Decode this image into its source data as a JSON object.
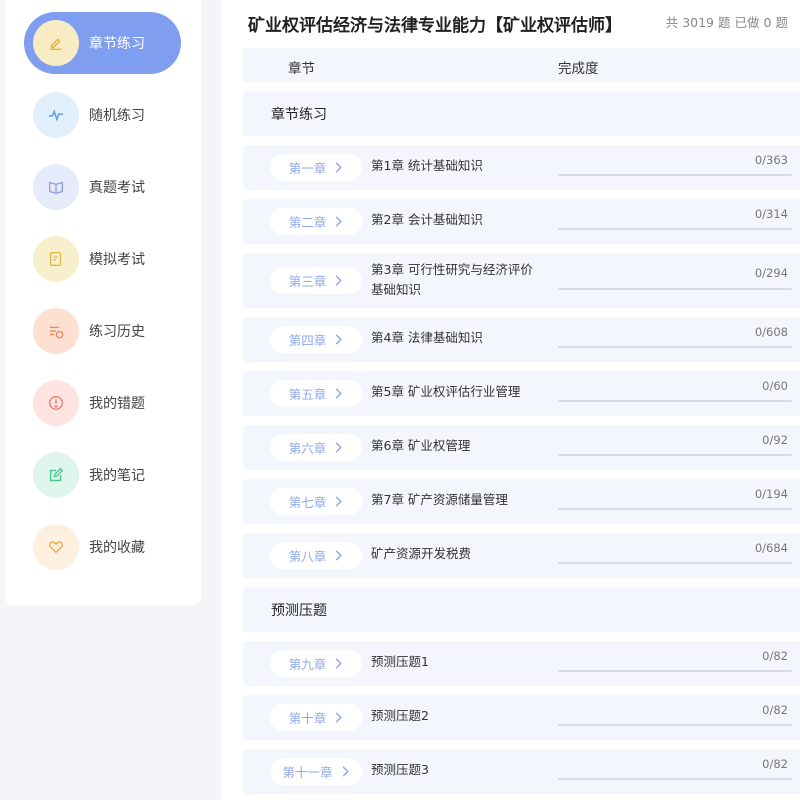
{
  "sidebar": {
    "items": [
      {
        "label": "章节练习",
        "icon": "pencil-icon",
        "active": true,
        "icon_bg": "#f7ecc3",
        "icon_color": "#e8b44a"
      },
      {
        "label": "随机练习",
        "icon": "pulse-icon",
        "active": false,
        "icon_bg": "#e2f0fb",
        "icon_color": "#5b9be6"
      },
      {
        "label": "真题考试",
        "icon": "book-icon",
        "active": false,
        "icon_bg": "#e6ebfb",
        "icon_color": "#8d9fe4"
      },
      {
        "label": "模拟考试",
        "icon": "edit-document-icon",
        "active": false,
        "icon_bg": "#f8efcc",
        "icon_color": "#e7b64a"
      },
      {
        "label": "练习历史",
        "icon": "history-list-icon",
        "active": false,
        "icon_bg": "#fde0d2",
        "icon_color": "#f0875a"
      },
      {
        "label": "我的错题",
        "icon": "alert-circle-icon",
        "active": false,
        "icon_bg": "#fde3e1",
        "icon_color": "#ee7c70"
      },
      {
        "label": "我的笔记",
        "icon": "note-edit-icon",
        "active": false,
        "icon_bg": "#def6ec",
        "icon_color": "#45c48d"
      },
      {
        "label": "我的收藏",
        "icon": "heart-icon",
        "active": false,
        "icon_bg": "#fdf0de",
        "icon_color": "#f0a854"
      }
    ]
  },
  "header": {
    "title": "矿业权评估经济与法律专业能力【矿业权评估师】",
    "total_prefix": "共",
    "total_count": "3019",
    "total_suffix": "题",
    "done_prefix": "已做",
    "done_count": "0",
    "done_suffix": "题"
  },
  "table": {
    "col_chapter": "章节",
    "col_progress": "完成度"
  },
  "sections": [
    {
      "title": "章节练习",
      "rows": [
        {
          "btn": "第一章",
          "name": "第1章  统计基础知识",
          "progress": "0/363",
          "done": 0,
          "total": 363
        },
        {
          "btn": "第二章",
          "name": "第2章  会计基础知识",
          "progress": "0/314",
          "done": 0,
          "total": 314
        },
        {
          "btn": "第三章",
          "name": "第3章  可行性研究与经济评价基础知识",
          "progress": "0/294",
          "done": 0,
          "total": 294
        },
        {
          "btn": "第四章",
          "name": "第4章  法律基础知识",
          "progress": "0/608",
          "done": 0,
          "total": 608
        },
        {
          "btn": "第五章",
          "name": "第5章  矿业权评估行业管理",
          "progress": "0/60",
          "done": 0,
          "total": 60
        },
        {
          "btn": "第六章",
          "name": "第6章  矿业权管理",
          "progress": "0/92",
          "done": 0,
          "total": 92
        },
        {
          "btn": "第七章",
          "name": "第7章  矿产资源储量管理",
          "progress": "0/194",
          "done": 0,
          "total": 194
        },
        {
          "btn": "第八章",
          "name": "矿产资源开发税费",
          "progress": "0/684",
          "done": 0,
          "total": 684
        }
      ]
    },
    {
      "title": "预测压题",
      "rows": [
        {
          "btn": "第九章",
          "name": "预测压题1",
          "progress": "0/82",
          "done": 0,
          "total": 82
        },
        {
          "btn": "第十章",
          "name": "预测压题2",
          "progress": "0/82",
          "done": 0,
          "total": 82
        },
        {
          "btn": "第十一章",
          "name": "预测压题3",
          "progress": "0/82",
          "done": 0,
          "total": 82
        }
      ]
    }
  ]
}
